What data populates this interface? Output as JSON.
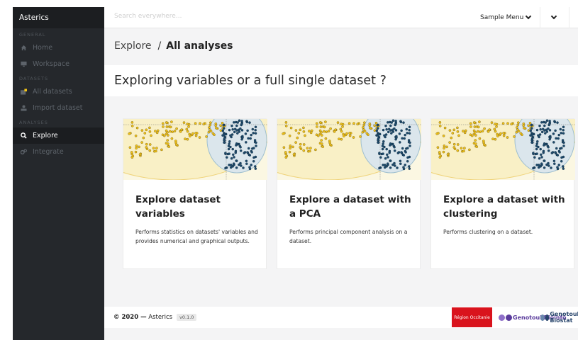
{
  "app": {
    "brand": "Asterics"
  },
  "sidebar": {
    "sections": [
      "GENERAL",
      "DATASETS",
      "ANALYSES"
    ],
    "items": [
      {
        "label": "Home",
        "icon": "home-icon"
      },
      {
        "label": "Workspace",
        "icon": "monitor-icon"
      },
      {
        "label": "All datasets",
        "icon": "datasets-icon"
      },
      {
        "label": "Import dataset",
        "icon": "upload-icon"
      },
      {
        "label": "Explore",
        "icon": "search-icon",
        "active": true
      },
      {
        "label": "Integrate",
        "icon": "cogs-icon"
      }
    ]
  },
  "topbar": {
    "search_placeholder": "Search everywhere...",
    "menu_label": "Sample Menu"
  },
  "breadcrumb": {
    "first": "Explore",
    "separator": "/",
    "current": "All analyses"
  },
  "page": {
    "heading": "Exploring variables or a full single dataset ?"
  },
  "cards": [
    {
      "title": "Explore dataset variables",
      "description": "Performs statistics on datasets' variables and provides numerical and graphical outputs."
    },
    {
      "title": "Explore a dataset with a PCA",
      "description": "Performs principal component analysis on a dataset."
    },
    {
      "title": "Explore a dataset with clustering",
      "description": "Performs clustering on a dataset."
    }
  ],
  "footer": {
    "copyright": "© 2020 —",
    "app_name": "Asterics",
    "version": "v0.1.0",
    "logos": [
      {
        "text": "Région Occitanie"
      },
      {
        "text": "Genotoul Bioinfo"
      },
      {
        "text": "Genotoul Biostat"
      }
    ]
  },
  "colors": {
    "sidebar": "#25282c",
    "active": "#1b1d20",
    "occitanie": "#d9131d",
    "yellow_cluster": "#f2c318",
    "blue_cluster": "#1d4a6b"
  }
}
